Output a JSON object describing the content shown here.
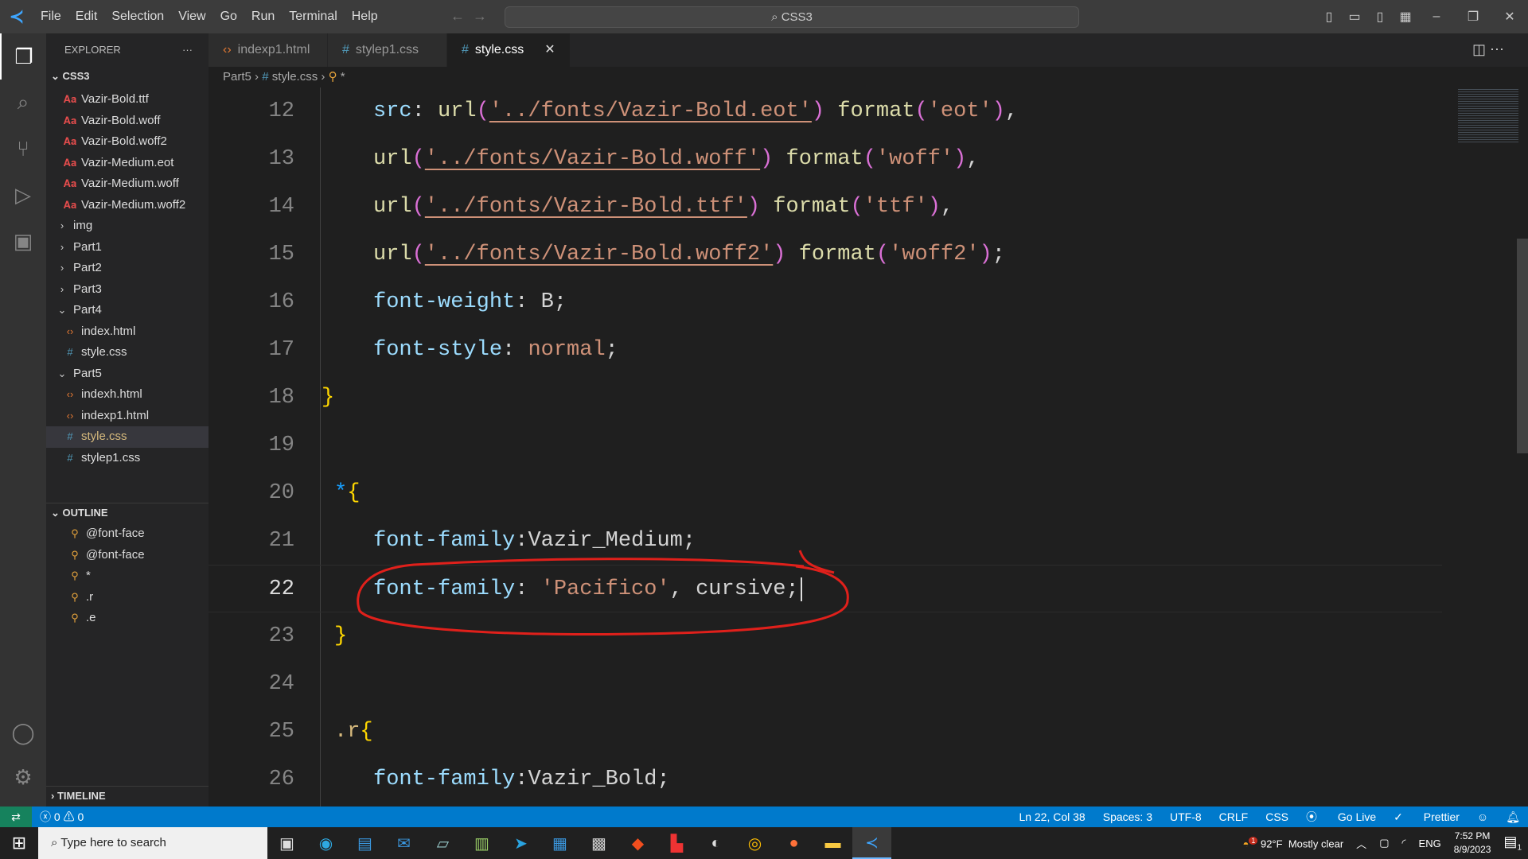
{
  "titlebar": {
    "menu": [
      "File",
      "Edit",
      "Selection",
      "View",
      "Go",
      "Run",
      "Terminal",
      "Help"
    ],
    "search": "CSS3"
  },
  "sidebar": {
    "title": "EXPLORER",
    "more": "···",
    "root": "CSS3",
    "items": [
      {
        "label": "Vazir-Bold.ttf",
        "type": "font",
        "indent": 1
      },
      {
        "label": "Vazir-Bold.woff",
        "type": "font",
        "indent": 1
      },
      {
        "label": "Vazir-Bold.woff2",
        "type": "font",
        "indent": 1
      },
      {
        "label": "Vazir-Medium.eot",
        "type": "font",
        "indent": 1
      },
      {
        "label": "Vazir-Medium.woff",
        "type": "font",
        "indent": 1
      },
      {
        "label": "Vazir-Medium.woff2",
        "type": "font",
        "indent": 1
      },
      {
        "label": "img",
        "type": "folder-closed",
        "indent": 0
      },
      {
        "label": "Part1",
        "type": "folder-closed",
        "indent": 0
      },
      {
        "label": "Part2",
        "type": "folder-closed",
        "indent": 0
      },
      {
        "label": "Part3",
        "type": "folder-closed",
        "indent": 0
      },
      {
        "label": "Part4",
        "type": "folder-open",
        "indent": 0
      },
      {
        "label": "index.html",
        "type": "html",
        "indent": 1
      },
      {
        "label": "style.css",
        "type": "css",
        "indent": 1
      },
      {
        "label": "Part5",
        "type": "folder-open",
        "indent": 0
      },
      {
        "label": "indexh.html",
        "type": "html",
        "indent": 1
      },
      {
        "label": "indexp1.html",
        "type": "html",
        "indent": 1
      },
      {
        "label": "style.css",
        "type": "css",
        "indent": 1,
        "selected": true
      },
      {
        "label": "stylep1.css",
        "type": "css",
        "indent": 1
      }
    ],
    "outline_title": "OUTLINE",
    "outline": [
      "@font-face",
      "@font-face",
      "*",
      ".r",
      ".e"
    ],
    "timeline_title": "TIMELINE"
  },
  "tabs": [
    {
      "label": "indexp1.html",
      "icon": "html"
    },
    {
      "label": "stylep1.css",
      "icon": "css"
    },
    {
      "label": "style.css",
      "icon": "css",
      "active": true
    }
  ],
  "breadcrumb": [
    "Part5",
    "style.css",
    "*"
  ],
  "editor": {
    "current_line": 22,
    "lines": [
      {
        "n": 12,
        "indent": 2,
        "t": [
          [
            "src",
            "prop"
          ],
          [
            ": ",
            "pl"
          ],
          [
            "url",
            "fn"
          ],
          [
            "(",
            "p2"
          ],
          [
            "'../fonts/Vazir-Bold.eot'",
            "str ul"
          ],
          [
            ")",
            "p2"
          ],
          [
            " ",
            "pl"
          ],
          [
            "format",
            "fn"
          ],
          [
            "(",
            "p2"
          ],
          [
            "'eot'",
            "str"
          ],
          [
            ")",
            "p2"
          ],
          [
            ",",
            "pl"
          ]
        ]
      },
      {
        "n": 13,
        "indent": 2,
        "t": [
          [
            "url",
            "fn"
          ],
          [
            "(",
            "p2"
          ],
          [
            "'../fonts/Vazir-Bold.woff'",
            "str ul"
          ],
          [
            ")",
            "p2"
          ],
          [
            " ",
            "pl"
          ],
          [
            "format",
            "fn"
          ],
          [
            "(",
            "p2"
          ],
          [
            "'woff'",
            "str"
          ],
          [
            ")",
            "p2"
          ],
          [
            ",",
            "pl"
          ]
        ]
      },
      {
        "n": 14,
        "indent": 2,
        "t": [
          [
            "url",
            "fn"
          ],
          [
            "(",
            "p2"
          ],
          [
            "'../fonts/Vazir-Bold.ttf'",
            "str ul"
          ],
          [
            ")",
            "p2"
          ],
          [
            " ",
            "pl"
          ],
          [
            "format",
            "fn"
          ],
          [
            "(",
            "p2"
          ],
          [
            "'ttf'",
            "str"
          ],
          [
            ")",
            "p2"
          ],
          [
            ",",
            "pl"
          ]
        ]
      },
      {
        "n": 15,
        "indent": 2,
        "t": [
          [
            "url",
            "fn"
          ],
          [
            "(",
            "p2"
          ],
          [
            "'../fonts/Vazir-Bold.woff2'",
            "str ul"
          ],
          [
            ")",
            "p2"
          ],
          [
            " ",
            "pl"
          ],
          [
            "format",
            "fn"
          ],
          [
            "(",
            "p2"
          ],
          [
            "'woff2'",
            "str"
          ],
          [
            ")",
            "p2"
          ],
          [
            ";",
            "pl"
          ]
        ]
      },
      {
        "n": 16,
        "indent": 2,
        "t": [
          [
            "font-weight",
            "prop"
          ],
          [
            ": ",
            "pl"
          ],
          [
            "B",
            "pl"
          ],
          [
            ";",
            "pl"
          ]
        ]
      },
      {
        "n": 17,
        "indent": 2,
        "t": [
          [
            "font-style",
            "prop"
          ],
          [
            ": ",
            "pl"
          ],
          [
            "normal",
            "val"
          ],
          [
            ";",
            "pl"
          ]
        ]
      },
      {
        "n": 18,
        "indent": 0,
        "t": [
          [
            "}",
            "p1"
          ]
        ]
      },
      {
        "n": 19,
        "indent": 0,
        "t": []
      },
      {
        "n": 20,
        "indent": 1,
        "t": [
          [
            "*",
            "b3"
          ],
          [
            "{",
            "p1"
          ]
        ]
      },
      {
        "n": 21,
        "indent": 2,
        "t": [
          [
            "font-family",
            "prop"
          ],
          [
            ":",
            "pl"
          ],
          [
            "Vazir_Medium",
            "pl"
          ],
          [
            ";",
            "pl"
          ]
        ]
      },
      {
        "n": 22,
        "indent": 2,
        "t": [
          [
            "font-family",
            "prop"
          ],
          [
            ": ",
            "pl"
          ],
          [
            "'Pacifico'",
            "str"
          ],
          [
            ", ",
            "pl"
          ],
          [
            "cursive",
            "pl"
          ],
          [
            ";",
            "pl"
          ]
        ]
      },
      {
        "n": 23,
        "indent": 1,
        "t": [
          [
            "}",
            "p1"
          ]
        ]
      },
      {
        "n": 24,
        "indent": 0,
        "t": []
      },
      {
        "n": 25,
        "indent": 1,
        "t": [
          [
            ".r",
            "sel"
          ],
          [
            "{",
            "p1"
          ]
        ]
      },
      {
        "n": 26,
        "indent": 2,
        "t": [
          [
            "font-family",
            "prop"
          ],
          [
            ":",
            "pl"
          ],
          [
            "Vazir_Bold",
            "pl"
          ],
          [
            ";",
            "pl"
          ]
        ]
      }
    ]
  },
  "status": {
    "errors": "0",
    "warnings": "0",
    "position": "Ln 22, Col 38",
    "spaces": "Spaces: 3",
    "encoding": "UTF-8",
    "eol": "CRLF",
    "language": "CSS",
    "golive": "Go Live",
    "prettier": "Prettier"
  },
  "taskbar": {
    "search_placeholder": "Type here to search",
    "weather": "92°F",
    "weather_desc": "Mostly clear",
    "weather_badge": "1",
    "lang": "ENG",
    "time": "7:52 PM",
    "date": "8/9/2023",
    "notif_count": "1"
  },
  "colors": {
    "accent": "#007acc",
    "annotation": "#e0201b"
  }
}
